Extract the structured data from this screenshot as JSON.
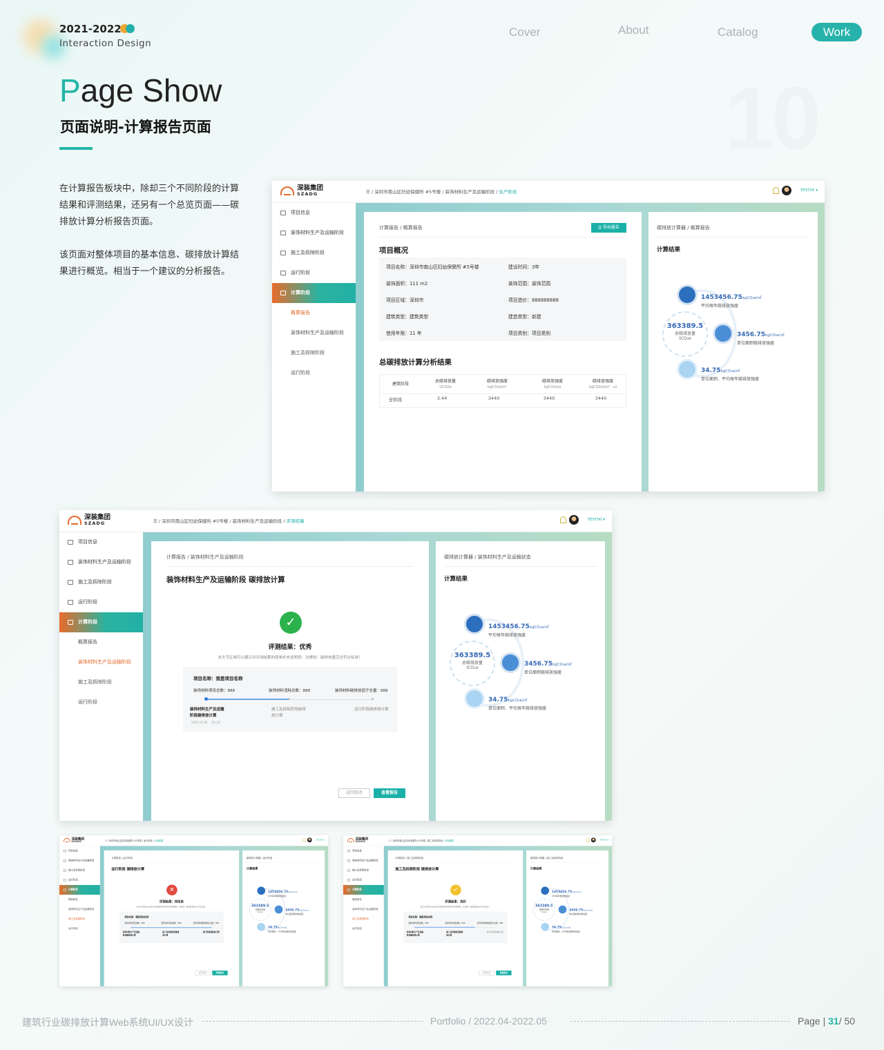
{
  "header": {
    "year": "2021-2022",
    "subtitle": "Interaction Design",
    "nav": [
      "Cover",
      "About",
      "Catalog",
      "Work"
    ]
  },
  "section": {
    "title_initial": "P",
    "title_rest": "age Show",
    "subtitle": "页面说明-计算报告页面",
    "number": "10",
    "para1": "在计算报告板块中，除却三个不同阶段的计算结果和评测结果，还另有一个总览页面——碳排放计算分析报告页面。",
    "para2": "该页面对整体项目的基本信息、碳排放计算结果进行概览。相当于一个建议的分析报告。"
  },
  "app": {
    "logo_cn": "深装集团",
    "logo_en": "SZADG",
    "user": "TEST00",
    "crumb_base": "深圳市南山区妇幼保健所 #5号楼",
    "crumb_stage": "装饰材料生产及运输阶段",
    "crumb_active1": "生产阶段",
    "crumb_active2": "评测结果",
    "menu": [
      "项目信息",
      "装饰材料生产及运输阶段",
      "施工及拆除阶段",
      "运行阶段",
      "计算阶段"
    ],
    "submenu": [
      "概算报告",
      "装饰材料生产及运输阶段",
      "施工及拆除阶段",
      "运行阶段"
    ]
  },
  "screen1": {
    "card_title": "计算报告 / 概算报告",
    "export": "导出报告",
    "overview_title": "项目概况",
    "info": [
      [
        "项目名称：深圳市南山区妇幼保健所 #5号楼",
        "建设时间：3年"
      ],
      [
        "装饰面积：111 m2",
        "装饰范围：装饰范围"
      ],
      [
        "项目区域：深圳市",
        "项目造价：888888888"
      ],
      [
        "建筑类型：建筑类型",
        "建造类型：新建"
      ],
      [
        "使用年限：11 年",
        "项目类别：项目类别"
      ]
    ],
    "analysis_title": "总碳排放计算分析结果",
    "table_headers": [
      [
        "建筑阶段",
        ""
      ],
      [
        "总碳排放量",
        "t/CO2e"
      ],
      [
        "碳排放强度",
        "kgCO2e/m²"
      ],
      [
        "碳排放强度",
        "kgCO2e/a"
      ],
      [
        "碳排放强度",
        "kgCO2e/(m² · a)"
      ]
    ],
    "table_row": [
      "全阶段",
      "3.44",
      "3440",
      "3440",
      "3440"
    ],
    "right_title": "碳排放计算器 / 概算报告",
    "result_title": "计算结果"
  },
  "result": {
    "total_value": "363389.5",
    "total_label": "总碳排放量",
    "total_unit": "tCO₂e",
    "v1": "1453456.75",
    "v1_unit": "kgCO₂e/㎡",
    "v1_desc": "平均每年碳排放强度",
    "v2": "3456.75",
    "v2_unit": "kgCO₂e/㎡",
    "v2_desc": "单位面积碳排放强度",
    "v3": "34.75",
    "v3_unit": "kgCO₂e/㎡",
    "v3_desc": "单位面积、平均每年碳排放强度"
  },
  "screen2": {
    "card_title": "计算报告 / 装饰材料生产及运输阶段",
    "page_title": "装饰材料生产及运输阶段 碳排放计算",
    "result_label": "评测结果：优秀",
    "result_desc": "本文字区域可以展示对评测结果的简单补充说明例：太棒啦！碳排放量完全符合标准！",
    "proj_name": "项目名称：我是项目名称",
    "stat1": "装饰材料项目总数：888",
    "stat2": "装饰材料消耗总数：888",
    "stat3": "装饰材料碳排放因子总量：888",
    "step1": "装饰材料生产及运输阶段碳排放计算",
    "step1_time": "2021-4-16    12:32",
    "step2": "施工及拆除阶段碳排放计算",
    "step3": "运行阶段碳排放计算",
    "btn_back": "返回修改",
    "btn_view": "查看报告",
    "right_title": "碳排放计算器 / 装饰材料生产及运输状态",
    "result_title": "计算结果"
  },
  "screen3": {
    "card_title": "计算报告 / 运行阶段",
    "page_title": "运行阶段 碳排放计算",
    "result_label": "评测结果：待改进",
    "right_title": "碳排放计算器 / 运行阶段"
  },
  "screen4": {
    "card_title": "计算报告 / 施工及拆除阶段",
    "page_title": "施工及拆除阶段 碳排放计算",
    "result_label": "评测结果：良好",
    "right_title": "碳排放计算器 / 施工及拆除阶段"
  },
  "footer": {
    "left": "建筑行业碳排放计算Web系统UI/UX设计",
    "mid": "Portfolio / 2022.04-2022.05",
    "page_label": "Page | ",
    "page_num": "31",
    "page_total": "/ 50"
  },
  "colors": {
    "accent": "#27b3ab",
    "orange": "#e26a2b",
    "blue": "#3569b5"
  }
}
